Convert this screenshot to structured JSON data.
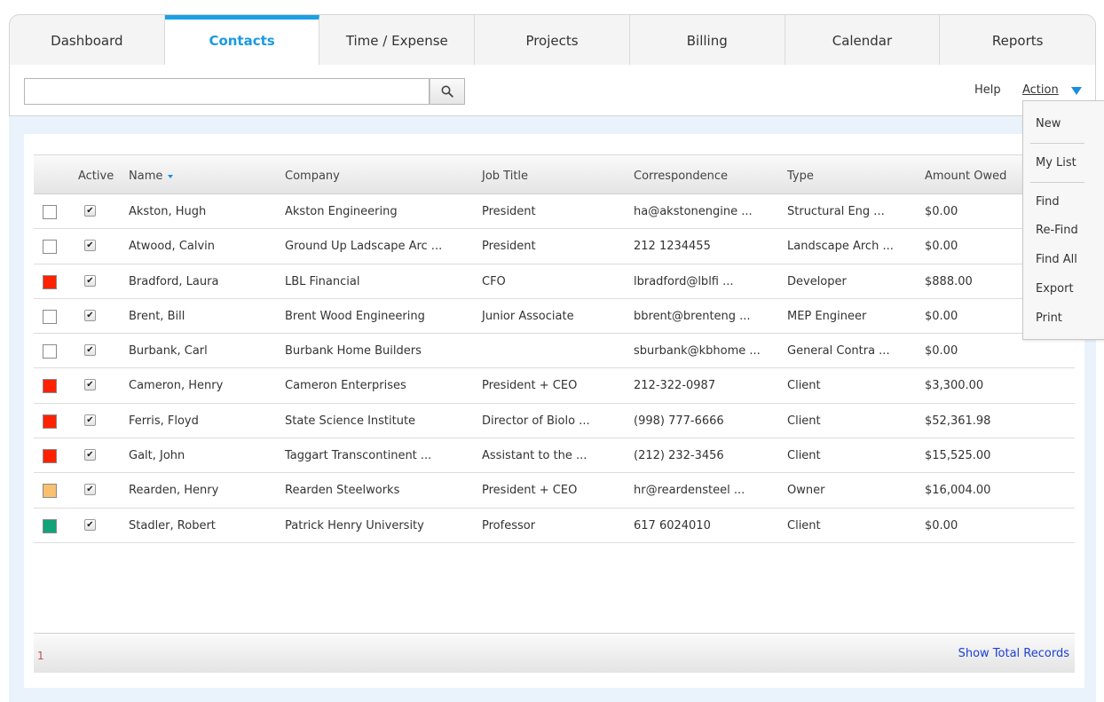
{
  "tabs": [
    {
      "label": "Dashboard"
    },
    {
      "label": "Contacts"
    },
    {
      "label": "Time / Expense"
    },
    {
      "label": "Projects"
    },
    {
      "label": "Billing"
    },
    {
      "label": "Calendar"
    },
    {
      "label": "Reports"
    }
  ],
  "active_tab": "Contacts",
  "toolbar": {
    "search_value": "",
    "search_icon": "search-icon",
    "help_label": "Help",
    "action_label": "Action"
  },
  "grid": {
    "headers": {
      "active": "Active",
      "name": "Name",
      "company": "Company",
      "job_title": "Job Title",
      "correspondence": "Correspondence",
      "type": "Type",
      "amount_owed": "Amount Owed"
    },
    "rows": [
      {
        "color": "",
        "active": true,
        "name": "Akston, Hugh",
        "company": "Akston Engineering",
        "job_title": "President",
        "correspondence": "ha@akstonengine ...",
        "type": "Structural Eng ...",
        "amount": "$0.00"
      },
      {
        "color": "",
        "active": true,
        "name": "Atwood, Calvin",
        "company": "Ground Up Ladscape Arc ...",
        "job_title": "President",
        "correspondence": "212 1234455",
        "type": "Landscape Arch ...",
        "amount": "$0.00"
      },
      {
        "color": "#ff2200",
        "active": true,
        "name": "Bradford, Laura",
        "company": "LBL Financial",
        "job_title": "CFO",
        "correspondence": "lbradford@lblfi ...",
        "type": "Developer",
        "amount": "$888.00"
      },
      {
        "color": "",
        "active": true,
        "name": "Brent, Bill",
        "company": "Brent Wood Engineering",
        "job_title": "Junior Associate",
        "correspondence": "bbrent@brenteng ...",
        "type": "MEP Engineer",
        "amount": "$0.00"
      },
      {
        "color": "",
        "active": true,
        "name": "Burbank, Carl",
        "company": "Burbank Home Builders",
        "job_title": "",
        "correspondence": "sburbank@kbhome ...",
        "type": "General Contra ...",
        "amount": "$0.00"
      },
      {
        "color": "#ff2200",
        "active": true,
        "name": "Cameron, Henry",
        "company": "Cameron Enterprises",
        "job_title": "President + CEO",
        "correspondence": "212-322-0987",
        "type": "Client",
        "amount": "$3,300.00"
      },
      {
        "color": "#ff2200",
        "active": true,
        "name": "Ferris, Floyd",
        "company": "State Science Institute",
        "job_title": "Director of Biolo ...",
        "correspondence": "(998) 777-6666",
        "type": "Client",
        "amount": "$52,361.98"
      },
      {
        "color": "#ff2200",
        "active": true,
        "name": "Galt, John",
        "company": "Taggart Transcontinent ...",
        "job_title": "Assistant to the ...",
        "correspondence": "(212) 232-3456",
        "type": "Client",
        "amount": "$15,525.00"
      },
      {
        "color": "#f9c06f",
        "active": true,
        "name": "Rearden, Henry",
        "company": "Rearden Steelworks",
        "job_title": "President + CEO",
        "correspondence": "hr@reardensteel ...",
        "type": "Owner",
        "amount": "$16,004.00"
      },
      {
        "color": "#11a37a",
        "active": true,
        "name": "Stadler, Robert",
        "company": "Patrick Henry University",
        "job_title": "Professor",
        "correspondence": "617 6024010",
        "type": "Client",
        "amount": "$0.00"
      }
    ]
  },
  "footer": {
    "page": "1",
    "show_total_label": "Show Total Records"
  },
  "action_menu": {
    "items": [
      "New",
      "My List",
      "Find",
      "Re-Find",
      "Find All",
      "Export",
      "Print"
    ]
  },
  "colors": {
    "accent": "#1aa0e6",
    "link": "#1e40d6",
    "page_bg": "#eaf3fb"
  }
}
